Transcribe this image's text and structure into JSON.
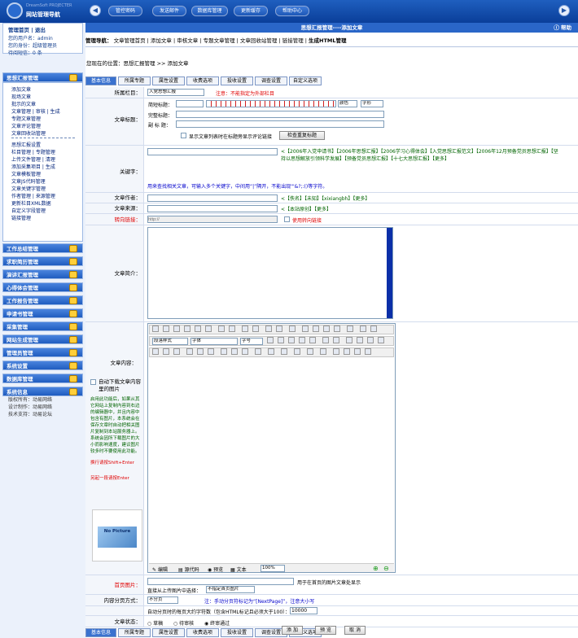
{
  "topbar": {
    "logo_small": "DreamSoft PROJECTER",
    "logo_title": "网站管理导航",
    "nav_buttons": [
      "管控密码",
      "发送邮件",
      "数据库管理",
      "更新缓存",
      "帮助中心"
    ]
  },
  "sidebar": {
    "home_label": "管理首页",
    "logout_label": "退出",
    "username_line": "您的用户名：admin",
    "identity_line": "您的身份：超级管理员",
    "messages_line": "待阅短信：0 条",
    "active_category": "思想汇报管理",
    "subitems": [
      "添加文章",
      "现场文章",
      "批示的文章",
      "文章管理 | 审核 | 生成",
      "专题文章管理",
      "文章评论管理",
      "文章回收站管理",
      "思想汇报设置",
      "栏目管理 | 专题管理",
      "上传文件管理 | 清理",
      "添加采集项目 | 生成",
      "文章模板管理",
      "文章JS代码管理",
      "文章关键字管理",
      "作者管理 | 来源管理",
      "更新栏目XML数据",
      "自定义字段管理",
      "链接管理"
    ],
    "categories": [
      "工作总结管理",
      "求职简历管理",
      "演讲汇报管理",
      "心得体会管理",
      "工作报告管理",
      "申请书管理",
      "采集管理",
      "网站生成管理",
      "管理员管理",
      "系统设置",
      "数据库管理",
      "系统信息"
    ],
    "footer": [
      {
        "k": "版权所有：",
        "v": "动易网络"
      },
      {
        "k": "设计制作：",
        "v": "动易网络"
      },
      {
        "k": "技术支持：",
        "v": "动易论坛"
      }
    ]
  },
  "main": {
    "title": "思想汇报管理----添加文章",
    "help_label": "帮助",
    "nav_label": "管理导航：",
    "nav_items": [
      "文章管理首页",
      "添加文章",
      "审核文章",
      "专题文章管理",
      "文章回收站管理",
      "链接管理",
      "生成HTML管理"
    ],
    "breadcrumb": "您现在的位置：思想汇报管理 >> 添加文章",
    "tabs": [
      "基本信息",
      "所属专题",
      "属性设置",
      "收费选项",
      "投收设置",
      "调查设置",
      "自定义选项"
    ],
    "form": {
      "column_label": "所属栏目：",
      "column_value": "入党思想汇报",
      "column_note": "注意：不能指定为外部栏目",
      "title_label": "文章标题：",
      "short_title_label": "简短标题：",
      "full_title_label": "完整标题：",
      "sub_title_label": "副 标 题：",
      "color_select": "颜色",
      "font_select": "字形",
      "show_in_list_label": "显示文章列表时在标题旁显示评论链接",
      "check_title_button": "检查重复标题",
      "keyword_label": "关键字：",
      "keyword_links": "<【2006年入党申请书】【2006年思想汇报】【2006学习心得体会】【入党思想汇报范文】【2006年12月预备党员思想汇报】【坚持以思想解放引领科学发展】【预备党员思想汇报】【十七大思想汇报】【更多】",
      "keyword_help": "用来查找相关文章，可输入多个关键字，中间用“|”隔开，不能出现\"'&?;:()等字符。",
      "author_label": "文章作者：",
      "author_links": "<【佚名】【未知】【xixiangbh】【更多】",
      "source_label": "文章来源：",
      "source_links": "<【本站原创】【更多】",
      "redirect_label": "转向链接：",
      "redirect_placeholder": "http://",
      "use_redirect_label": "使用转向链接",
      "summary_label": "文章简介：",
      "content_label": "文章内容：",
      "auto_download_label": "自动下载文章内容里的图片",
      "auto_download_help": "启用此功能后，如果从其它网站上复制内容到右边的编辑器中，并且内容中包含有图片，本系统会在保存文章时自动把相关图片复制到本站服务器上。系统会因所下载图片的大小而影响速度，建议图片较多时不要使用此功能。",
      "hint1": "换行请按Shift+Enter",
      "hint2": "另起一段请按Enter",
      "editor_style": "段落样式",
      "editor_font": "字体",
      "editor_size": "字号",
      "editor_tabs": [
        "编辑",
        "源代码",
        "预览",
        "文本"
      ],
      "zoom": "100%",
      "no_picture": "No Picture",
      "homepage_pic_label": "首页图片：",
      "homepage_pic_note": "用于在首页的图片文章处显示",
      "select_upload_label": "直接从上传图片中选择：",
      "select_upload_value": "不指定首页图片",
      "paging_label": "内容分页方式：",
      "paging_value": "不分页",
      "paging_note": "注：手动分页符标记为“[NextPage]”，注意大小写",
      "auto_paging_label": "自动分页时的每页大约字符数（包含HTML标记且必须大于100）：",
      "auto_paging_value": "10000",
      "status_label": "文章状态：",
      "status_options": [
        "草稿",
        "待审核",
        "终审通过"
      ],
      "status_selected": "终审通过",
      "buttons": [
        "添 加",
        "预 览",
        "取 消"
      ]
    }
  }
}
